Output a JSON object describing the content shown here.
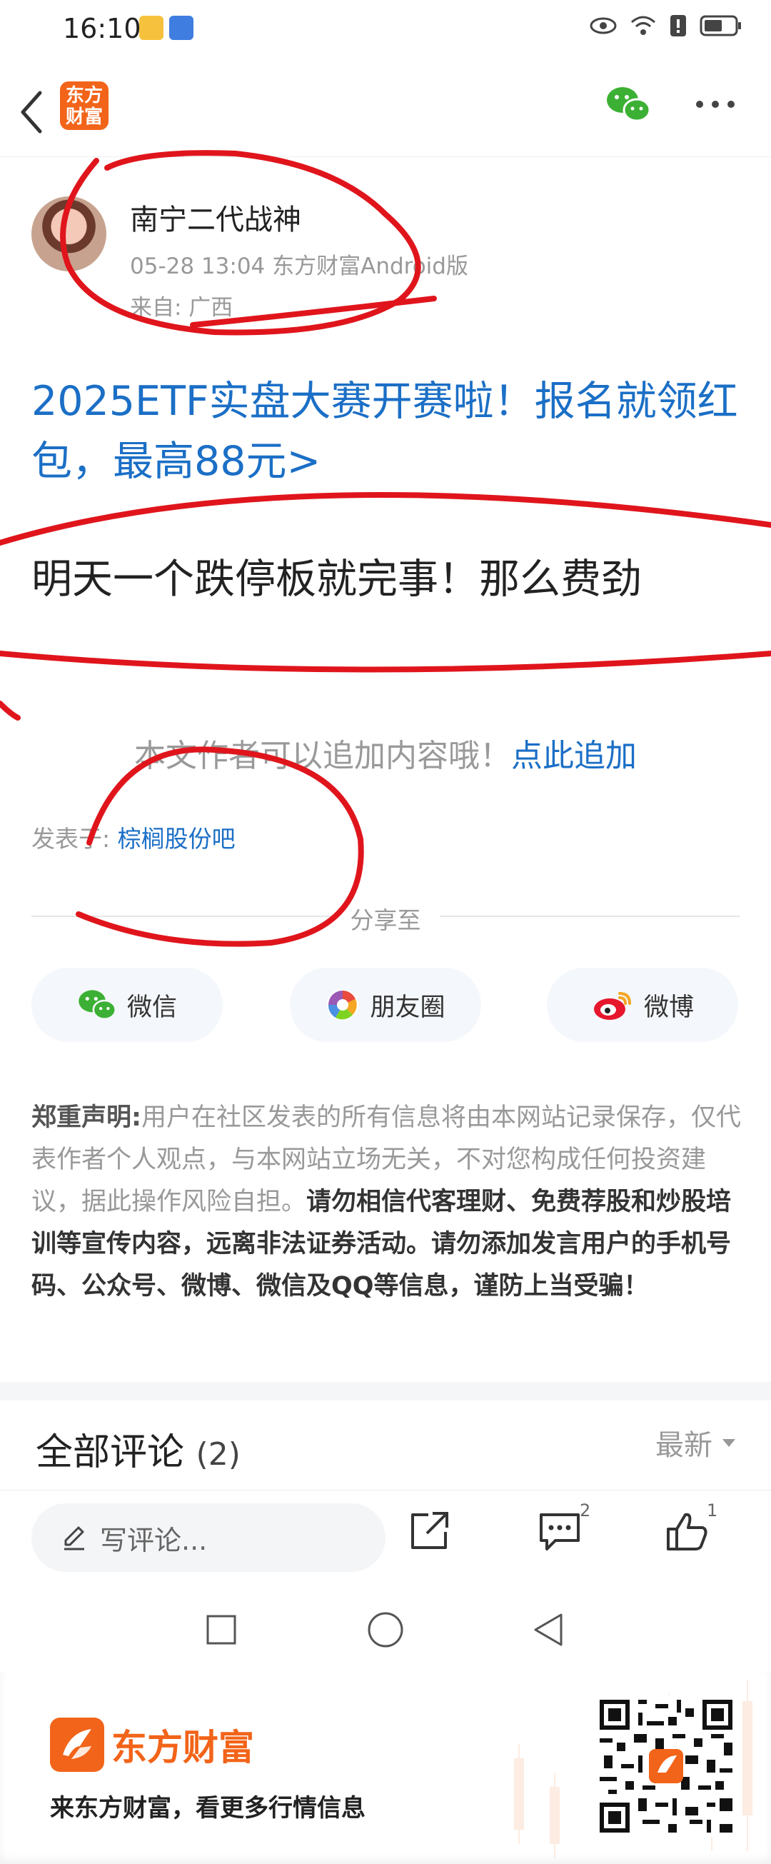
{
  "status_bar": {
    "time": "16:10"
  },
  "post": {
    "author_name": "南宁二代战神",
    "meta": "05-28 13:04 东方财富Android版",
    "location": "来自: 广西",
    "promo_text": "2025ETF实盘大赛开赛啦！报名就领红包，最高88元>",
    "body": "明天一个跌停板就完事！那么费劲",
    "append_text": "本文作者可以追加内容哦！",
    "append_link": "点此追加",
    "posted_in_label": "发表于:",
    "posted_in_forum": "棕榈股份吧"
  },
  "share": {
    "label": "分享至",
    "buttons": [
      "微信",
      "朋友圈",
      "微博"
    ]
  },
  "disclaimer": {
    "head": "郑重声明:",
    "normal": "用户在社区发表的所有信息将由本网站记录保存，仅代表作者个人观点，与本网站立场无关，不对您构成任何投资建议，据此操作风险自担。",
    "strong": "请勿相信代客理财、免费荐股和炒股培训等宣传内容，远离非法证券活动。请勿添加发言用户的手机号码、公众号、微博、微信及QQ等信息，谨防上当受骗！"
  },
  "comments": {
    "title": "全部评论",
    "count": "(2)",
    "sort": "最新"
  },
  "action_bar": {
    "input_placeholder": "写评论...",
    "comment_badge": "2",
    "like_badge": "1"
  },
  "app_logo": {
    "text": "东方财富"
  },
  "footer": {
    "brand": "东方财富",
    "tagline": "来东方财富，看更多行情信息"
  },
  "colors": {
    "brand_orange": "#f26419",
    "link_blue": "#1b6fc6",
    "annotation_red": "#e0151c"
  }
}
